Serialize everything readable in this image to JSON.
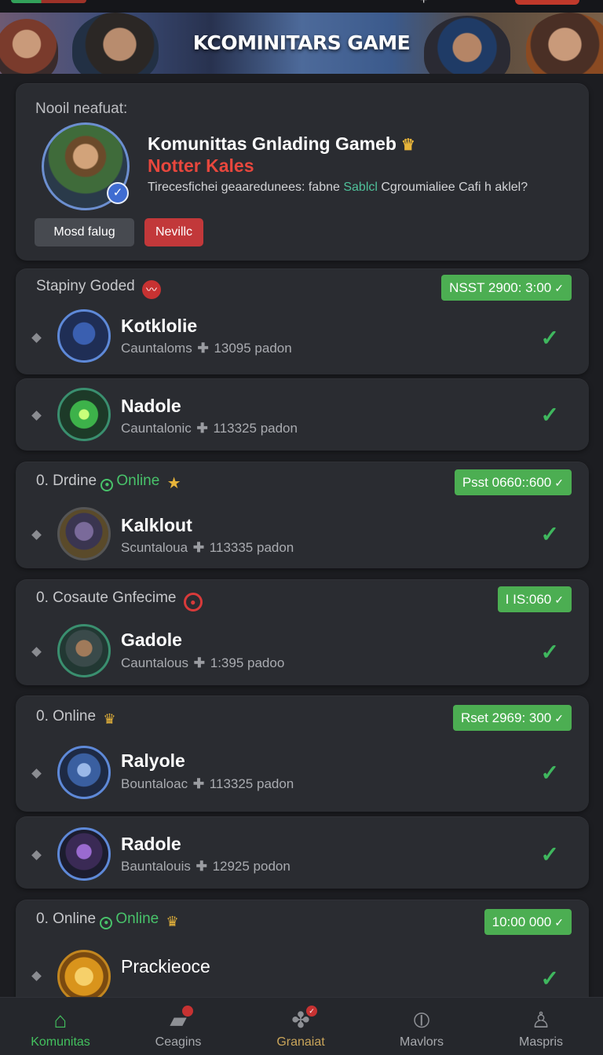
{
  "banner": {
    "title": "KCOMINITARS GAME"
  },
  "profile": {
    "label": "Nooil neafuat:",
    "name": "Komunittas Gnlading Gameb",
    "subtitle": "Notter Kales",
    "description_before": "Tirecesfichei geaaredunees: fabne ",
    "description_highlight": "Sablcl",
    "description_after": " Cgroumialiee Cafi h aklel?",
    "button_secondary": "Mosd falug",
    "button_primary": "Nevillc"
  },
  "sections": [
    {
      "title": "Stapiny Goded",
      "title_extra": "",
      "pill": "NSST 2900: 3:00",
      "rows": [
        {
          "name": "Kotklolie",
          "meta_prefix": "Cauntaloms",
          "meta_value": "13095 padon"
        },
        {
          "name": "Nadole",
          "meta_prefix": "Cauntalonic",
          "meta_value": "113325 padon"
        }
      ]
    },
    {
      "title": "0. Drdine",
      "title_extra": "Online",
      "pill": "Psst 0660::600",
      "rows": [
        {
          "name": "Kalklout",
          "meta_prefix": "Scuntaloua",
          "meta_value": "113335 padon"
        }
      ]
    },
    {
      "title": "0. Cosaute Gnfecime",
      "title_extra": "",
      "pill": "I IS:060",
      "rows": [
        {
          "name": "Gadole",
          "meta_prefix": "Cauntalous",
          "meta_value": "1:395 padoo"
        }
      ]
    },
    {
      "title": "0. Online",
      "title_extra": "",
      "pill": "Rset 2969: 300",
      "rows": [
        {
          "name": "Ralyole",
          "meta_prefix": "Bountaloac",
          "meta_value": "113325 padon"
        },
        {
          "name": "Radole",
          "meta_prefix": "Bauntalouis",
          "meta_value": "12925 podon"
        }
      ]
    },
    {
      "title": "0. Online",
      "title_extra": "Online",
      "pill": "10:00 000",
      "rows": [
        {
          "name": "Prackieoce",
          "meta_prefix": "",
          "meta_value": ""
        }
      ]
    }
  ],
  "nav": [
    {
      "label": "Komunitas",
      "icon": "home-icon"
    },
    {
      "label": "Ceagins",
      "icon": "cards-icon"
    },
    {
      "label": "Granaiat",
      "icon": "puzzle-icon"
    },
    {
      "label": "Mavlors",
      "icon": "compass-icon"
    },
    {
      "label": "Maspris",
      "icon": "profile-icon"
    }
  ],
  "colors": {
    "accent_green": "#48c26a",
    "accent_red": "#c2383a",
    "card_bg": "#2a2c31",
    "page_bg": "#1c1d21"
  }
}
